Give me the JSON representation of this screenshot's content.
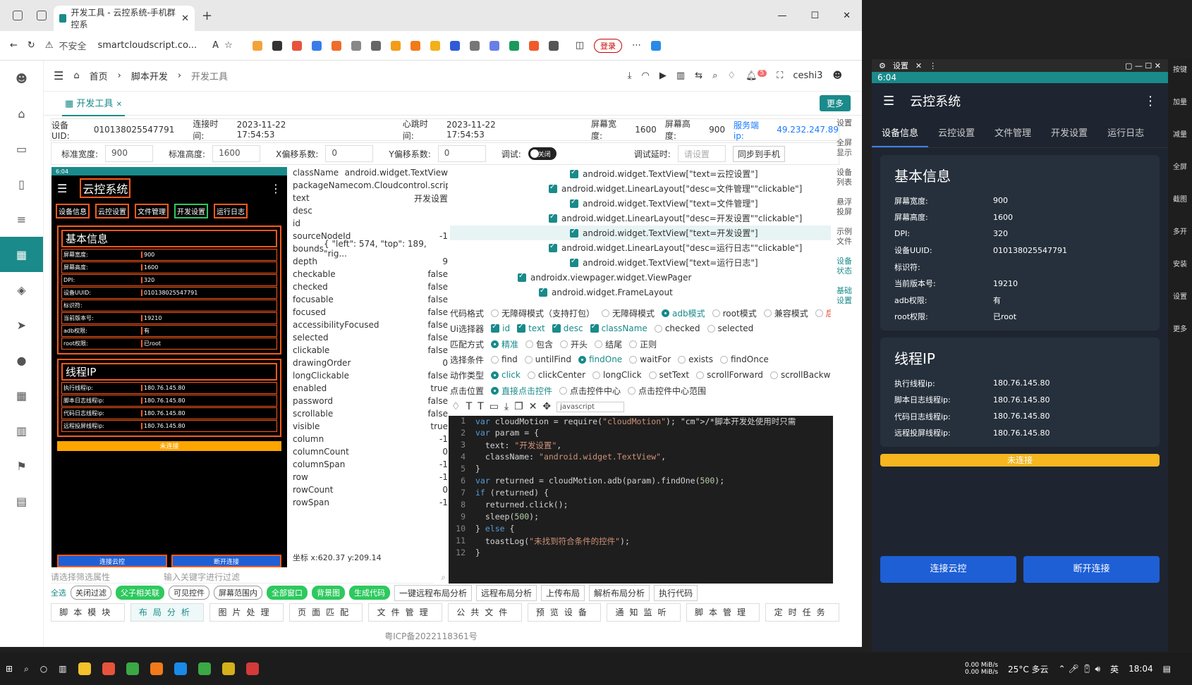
{
  "browser": {
    "tab_title": "开发工具 - 云控系统-手机群控系",
    "url_warning": "不安全",
    "url": "smartcloudscript.co...",
    "login": "登录"
  },
  "app": {
    "breadcrumb": [
      "首页",
      "脚本开发",
      "开发工具"
    ],
    "user": "ceshi3",
    "badge": "5",
    "tab": "开发工具",
    "more": "更多"
  },
  "info": {
    "uid_label": "设备UID:",
    "uid": "010138025547791",
    "conn_label": "连接时间:",
    "conn": "2023-11-22 17:54:53",
    "hb_label": "心跳时间:",
    "hb": "2023-11-22 17:54:53",
    "sw_label": "屏幕宽度:",
    "sw": "1600",
    "sh_label": "屏幕高度:",
    "sh": "900",
    "ip_label": "服务端ip:",
    "ip": "49.232.247.89"
  },
  "params": {
    "stdw_label": "标准宽度:",
    "stdw": "900",
    "stdh_label": "标准高度:",
    "stdh": "1600",
    "xoff_label": "X偏移系数:",
    "xoff": "0",
    "yoff_label": "Y偏移系数:",
    "yoff": "0",
    "debug_label": "调试:",
    "debug": "关闭",
    "delay_label": "调试延时:",
    "delay_placeholder": "请设置",
    "sync": "同步到手机"
  },
  "phone": {
    "time": "6:04",
    "title": "云控系统",
    "tabs": [
      "设备信息",
      "云控设置",
      "文件管理",
      "开发设置",
      "运行日志"
    ],
    "basic_title": "基本信息",
    "basic": [
      [
        "屏幕宽度:",
        "900"
      ],
      [
        "屏幕高度:",
        "1600"
      ],
      [
        "DPI:",
        "320"
      ],
      [
        "设备UUID:",
        "010138025547791"
      ],
      [
        "标识符:",
        ""
      ],
      [
        "当前版本号:",
        "19210"
      ],
      [
        "adb权限:",
        "有"
      ],
      [
        "root权限:",
        "已root"
      ]
    ],
    "ip_title": "线程IP",
    "ips": [
      [
        "执行线程ip:",
        "180.76.145.80"
      ],
      [
        "脚本日志线程ip:",
        "180.76.145.80"
      ],
      [
        "代码日志线程ip:",
        "180.76.145.80"
      ],
      [
        "远程投屏线程ip:",
        "180.76.145.80"
      ]
    ],
    "status": "未连接",
    "btn_connect": "连接云控",
    "btn_disconnect": "断开连接"
  },
  "attrs": [
    [
      "className",
      "android.widget.TextView"
    ],
    [
      "packageName",
      "com.Cloudcontrol.script"
    ],
    [
      "text",
      "开发设置"
    ],
    [
      "desc",
      ""
    ],
    [
      "id",
      ""
    ],
    [
      "sourceNodeId",
      "-1"
    ],
    [
      "bounds",
      "{ \"left\": 574, \"top\": 189, \"rig..."
    ],
    [
      "depth",
      "9"
    ],
    [
      "checkable",
      "false"
    ],
    [
      "checked",
      "false"
    ],
    [
      "focusable",
      "false"
    ],
    [
      "focused",
      "false"
    ],
    [
      "accessibilityFocused",
      "false"
    ],
    [
      "selected",
      "false"
    ],
    [
      "clickable",
      "false"
    ],
    [
      "drawingOrder",
      "0"
    ],
    [
      "longClickable",
      "false"
    ],
    [
      "enabled",
      "true"
    ],
    [
      "password",
      "false"
    ],
    [
      "scrollable",
      "false"
    ],
    [
      "visible",
      "true"
    ],
    [
      "column",
      "-1"
    ],
    [
      "columnCount",
      "0"
    ],
    [
      "columnSpan",
      "-1"
    ],
    [
      "row",
      "-1"
    ],
    [
      "rowCount",
      "0"
    ],
    [
      "rowSpan",
      "-1"
    ]
  ],
  "coords": "坐标 x:620.37 y:209.14",
  "tree": [
    "android.widget.TextView[\"text=云控设置\"]",
    "android.widget.LinearLayout[\"desc=文件管理\"\"clickable\"]",
    "android.widget.TextView[\"text=文件管理\"]",
    "android.widget.LinearLayout[\"desc=开发设置\"\"clickable\"]",
    "android.widget.TextView[\"text=开发设置\"]",
    "android.widget.LinearLayout[\"desc=运行日志\"\"clickable\"]",
    "android.widget.TextView[\"text=运行日志\"]",
    "androidx.viewpager.widget.ViewPager",
    "android.widget.FrameLayout"
  ],
  "options": {
    "r1_label": "代码格式",
    "r1": [
      "无障碍模式（支持打包）",
      "无障碍模式",
      "adb模式",
      "root模式",
      "兼容模式",
      "后面四"
    ],
    "r2_label": "Ui选择器",
    "r2": [
      "id",
      "text",
      "desc",
      "className",
      "checked",
      "selected"
    ],
    "r3_label": "匹配方式",
    "r3": [
      "精准",
      "包含",
      "开头",
      "结尾",
      "正则"
    ],
    "r4_label": "选择条件",
    "r4": [
      "find",
      "untilFind",
      "findOne",
      "waitFor",
      "exists",
      "findOnce"
    ],
    "r5_label": "动作类型",
    "r5": [
      "click",
      "clickCenter",
      "longClick",
      "setText",
      "scrollForward",
      "scrollBackward"
    ],
    "r6_label": "点击位置",
    "r6": [
      "直接点击控件",
      "点击控件中心",
      "点击控件中心范围"
    ],
    "lang": "javascript"
  },
  "code": [
    "var cloudMotion = require(\"cloudMotion\"); /*脚本开发处使用时只需",
    "var param = {",
    "  text: \"开发设置\",",
    "  className: \"android.widget.TextView\",",
    "}",
    "var returned = cloudMotion.adb(param).findOne(500);",
    "if (returned) {",
    "  returned.click();",
    "  sleep(500);",
    "} else {",
    "  toastLog(\"未找到符合条件的控件\");",
    "}"
  ],
  "side": [
    "设置",
    "全屏显示",
    "设备列表",
    "悬浮投屏",
    "示例文件",
    "设备状态",
    "基础设置"
  ],
  "filter": {
    "select": "请选择筛选属性",
    "input": "输入关键字进行过滤"
  },
  "chips": [
    "全选",
    "关闭过滤",
    "父子相关联",
    "可见控件",
    "屏幕范围内",
    "全部窗口",
    "背景图",
    "生成代码"
  ],
  "actions": [
    "一键远程布局分析",
    "远程布局分析",
    "上传布局",
    "解析布局分析",
    "执行代码"
  ],
  "nav": [
    "脚本模块",
    "布局分析",
    "图片处理",
    "页面匹配",
    "文件管理",
    "公共文件",
    "预览设备",
    "通知监听",
    "脚本管理",
    "定时任务"
  ],
  "icp": "粤ICP备2022118361号",
  "right": {
    "title": "设置",
    "time": "6:04",
    "app": "云控系统",
    "tabs": [
      "设备信息",
      "云控设置",
      "文件管理",
      "开发设置",
      "运行日志"
    ],
    "rail": [
      "按键",
      "加量",
      "减量",
      "全屏",
      "截图",
      "多开",
      "安装",
      "设置",
      "更多"
    ]
  },
  "taskbar": {
    "temp": "25°C 多云",
    "lang": "英",
    "time": "18:04",
    "net1": "0.00 MiB/s",
    "net2": "0.00 MiB/s"
  }
}
